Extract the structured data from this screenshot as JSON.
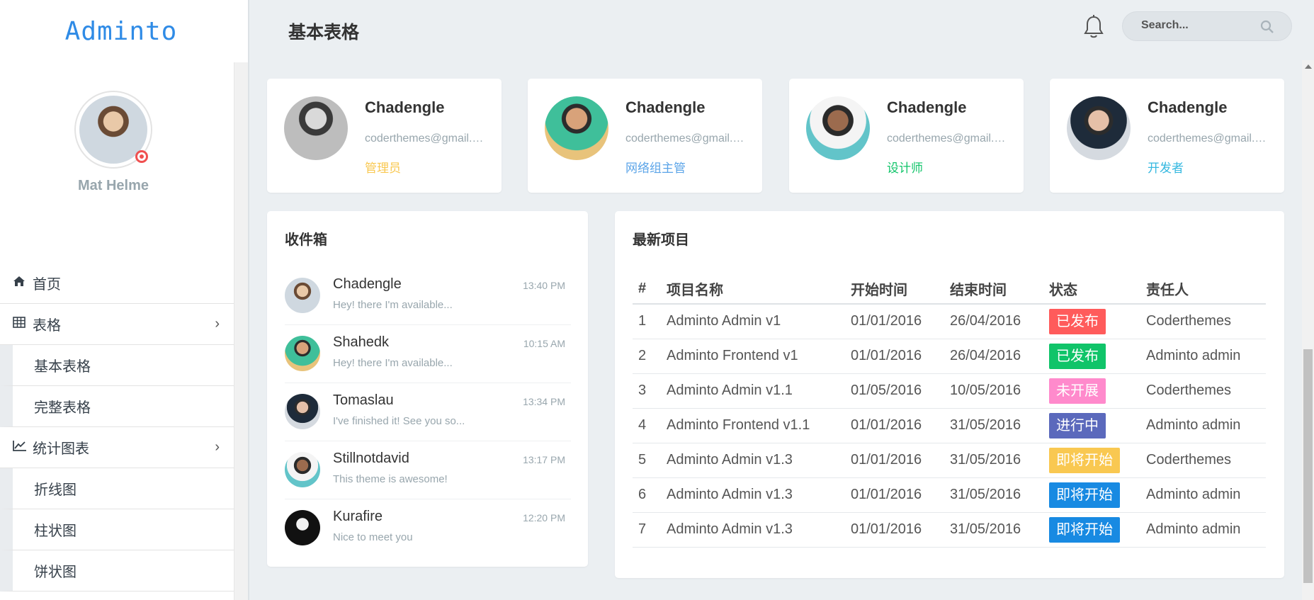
{
  "brand": {
    "logo_text": "Adminto"
  },
  "user": {
    "name": "Mat Helme"
  },
  "sidebar": {
    "items": [
      {
        "label": "首页",
        "icon": "home-icon"
      },
      {
        "label": "表格",
        "icon": "table-icon"
      },
      {
        "label": "基本表格"
      },
      {
        "label": "完整表格"
      },
      {
        "label": "统计图表",
        "icon": "line-chart-icon"
      },
      {
        "label": "折线图"
      },
      {
        "label": "柱状图"
      },
      {
        "label": "饼状图"
      }
    ]
  },
  "topbar": {
    "title": "基本表格",
    "search_placeholder": "Search..."
  },
  "profiles": [
    {
      "name": "Chadengle",
      "email": "coderthemes@gmail.com",
      "role": "管理员",
      "role_color": "#f9c851"
    },
    {
      "name": "Chadengle",
      "email": "coderthemes@gmail.com",
      "role": "网络组主管",
      "role_color": "#5ba4e8"
    },
    {
      "name": "Chadengle",
      "email": "coderthemes@gmail.com",
      "role": "设计师",
      "role_color": "#10c469"
    },
    {
      "name": "Chadengle",
      "email": "coderthemes@gmail.com",
      "role": "开发者",
      "role_color": "#35b8e0"
    }
  ],
  "inbox": {
    "title": "收件箱",
    "messages": [
      {
        "name": "Chadengle",
        "message": "Hey! there I'm available...",
        "time": "13:40 PM"
      },
      {
        "name": "Shahedk",
        "message": "Hey! there I'm available...",
        "time": "10:15 AM"
      },
      {
        "name": "Tomaslau",
        "message": "I've finished it! See you so...",
        "time": "13:34 PM"
      },
      {
        "name": "Stillnotdavid",
        "message": "This theme is awesome!",
        "time": "13:17 PM"
      },
      {
        "name": "Kurafire",
        "message": "Nice to meet you",
        "time": "12:20 PM"
      }
    ]
  },
  "projects": {
    "title": "最新项目",
    "headers": [
      "#",
      "项目名称",
      "开始时间",
      "结束时间",
      "状态",
      "责任人"
    ],
    "rows": [
      {
        "num": "1",
        "name": "Adminto Admin v1",
        "start": "01/01/2016",
        "end": "26/04/2016",
        "status": "已发布",
        "status_color": "#ff5b5b",
        "owner": "Coderthemes"
      },
      {
        "num": "2",
        "name": "Adminto Frontend v1",
        "start": "01/01/2016",
        "end": "26/04/2016",
        "status": "已发布",
        "status_color": "#10c469",
        "owner": "Adminto admin"
      },
      {
        "num": "3",
        "name": "Adminto Admin v1.1",
        "start": "01/05/2016",
        "end": "10/05/2016",
        "status": "未开展",
        "status_color": "#ff8acc",
        "owner": "Coderthemes"
      },
      {
        "num": "4",
        "name": "Adminto Frontend v1.1",
        "start": "01/01/2016",
        "end": "31/05/2016",
        "status": "进行中",
        "status_color": "#5b69bc",
        "owner": "Adminto admin"
      },
      {
        "num": "5",
        "name": "Adminto Admin v1.3",
        "start": "01/01/2016",
        "end": "31/05/2016",
        "status": "即将开始",
        "status_color": "#f9c851",
        "owner": "Coderthemes"
      },
      {
        "num": "6",
        "name": "Adminto Admin v1.3",
        "start": "01/01/2016",
        "end": "31/05/2016",
        "status": "即将开始",
        "status_color": "#188ae2",
        "owner": "Adminto admin"
      },
      {
        "num": "7",
        "name": "Adminto Admin v1.3",
        "start": "01/01/2016",
        "end": "31/05/2016",
        "status": "即将开始",
        "status_color": "#188ae2",
        "owner": "Adminto admin"
      }
    ]
  }
}
